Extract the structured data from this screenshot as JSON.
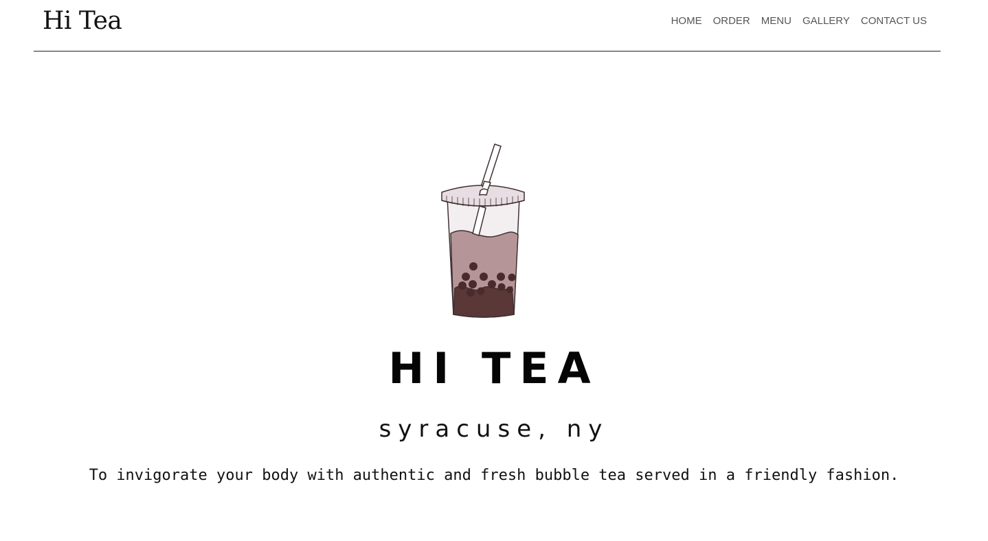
{
  "header": {
    "brand": "Hi Tea",
    "nav": [
      {
        "label": "HOME"
      },
      {
        "label": "ORDER"
      },
      {
        "label": "MENU"
      },
      {
        "label": "GALLERY"
      },
      {
        "label": "CONTACT US"
      }
    ]
  },
  "hero": {
    "logo_text": "HI TEA",
    "location": "syracuse, ny",
    "mission": "To invigorate your body with authentic and fresh bubble tea served in a friendly fashion.",
    "logo_icon": "bubble-tea-cup-icon",
    "colors": {
      "lid": "#e7dde2",
      "tea": "#b69598",
      "pearls": "#4a2b2b",
      "outline": "#3f3030"
    }
  }
}
